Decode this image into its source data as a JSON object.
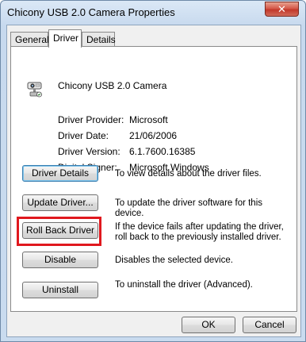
{
  "window": {
    "title": "Chicony USB 2.0 Camera Properties",
    "close_glyph": "✕"
  },
  "tabs": [
    {
      "label": "General"
    },
    {
      "label": "Driver"
    },
    {
      "label": "Details"
    }
  ],
  "device": {
    "name": "Chicony USB 2.0 Camera",
    "icon": "camera-icon"
  },
  "driver_info": [
    {
      "label": "Driver Provider:",
      "value": "Microsoft"
    },
    {
      "label": "Driver Date:",
      "value": "21/06/2006"
    },
    {
      "label": "Driver Version:",
      "value": "6.1.7600.16385"
    },
    {
      "label": "Digital Signer:",
      "value": "Microsoft Windows"
    }
  ],
  "actions": [
    {
      "label": "Driver Details",
      "description": "To view details about the driver files."
    },
    {
      "label": "Update Driver...",
      "description": "To update the driver software for this device."
    },
    {
      "label": "Roll Back Driver",
      "description": "If the device fails after updating the driver, roll back to the previously installed driver."
    },
    {
      "label": "Disable",
      "description": "Disables the selected device."
    },
    {
      "label": "Uninstall",
      "description": "To uninstall the driver (Advanced)."
    }
  ],
  "footer": {
    "ok_label": "OK",
    "cancel_label": "Cancel"
  },
  "colors": {
    "highlight": "#e0181e",
    "close_button": "#c2382a"
  }
}
